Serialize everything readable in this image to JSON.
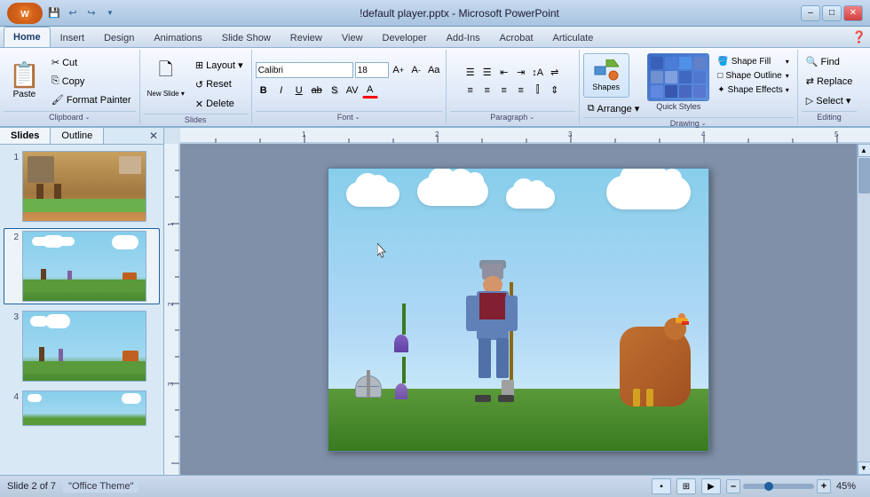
{
  "window": {
    "title": "!default player.pptx - Microsoft PowerPoint",
    "minimize": "–",
    "maximize": "□",
    "close": "✕"
  },
  "quick_access": [
    "💾",
    "↩",
    "↪",
    "▼"
  ],
  "tabs": [
    "Home",
    "Insert",
    "Design",
    "Animations",
    "Slide Show",
    "Review",
    "View",
    "Developer",
    "Add-Ins",
    "Acrobat",
    "Articulate"
  ],
  "active_tab": "Home",
  "ribbon": {
    "groups": [
      {
        "id": "clipboard",
        "label": "Clipboard"
      },
      {
        "id": "slides",
        "label": "Slides"
      },
      {
        "id": "font",
        "label": "Font"
      },
      {
        "id": "paragraph",
        "label": "Paragraph"
      },
      {
        "id": "drawing",
        "label": "Drawing"
      },
      {
        "id": "editing",
        "label": "Editing"
      }
    ],
    "clipboard": {
      "paste_label": "Paste",
      "cut_label": "Cut",
      "copy_label": "Copy",
      "format_label": "Format Painter"
    },
    "slides": {
      "new_label": "New\nSlide",
      "layout_label": "Layout",
      "reset_label": "Reset",
      "delete_label": "Delete"
    },
    "font": {
      "font_name": "Calibri",
      "font_size": "18",
      "bold": "B",
      "italic": "I",
      "underline": "U",
      "strikethrough": "S",
      "shadow": "s",
      "char_spacing": "AV",
      "increase_font": "A↑",
      "decrease_font": "A↓",
      "clear_format": "A",
      "font_color": "A"
    },
    "paragraph": {
      "bullets": "≡",
      "numbered": "≡",
      "decrease_indent": "←",
      "increase_indent": "→",
      "align_left": "≡",
      "center": "≡",
      "align_right": "≡",
      "justify": "≡",
      "columns": "⫿",
      "text_dir": "↕",
      "line_spacing": "↕",
      "convert": "⇌"
    },
    "drawing": {
      "shapes_label": "Shapes",
      "arrange_label": "Arrange",
      "quick_styles_label": "Quick Styles",
      "shape_fill_label": "Shape Fill",
      "shape_outline_label": "Shape Outline",
      "shape_effects_label": "Shape Effects"
    },
    "editing": {
      "find_label": "Find",
      "replace_label": "Replace",
      "select_label": "Select"
    }
  },
  "slides_panel": {
    "tabs": [
      "Slides",
      "Outline"
    ],
    "active": "Slides",
    "total": 7,
    "current": 2,
    "slides": [
      {
        "num": 1
      },
      {
        "num": 2
      },
      {
        "num": 3
      },
      {
        "num": 4
      }
    ]
  },
  "status_bar": {
    "slide_info": "Slide 2 of 7",
    "theme": "\"Office Theme\"",
    "zoom": "45%"
  }
}
